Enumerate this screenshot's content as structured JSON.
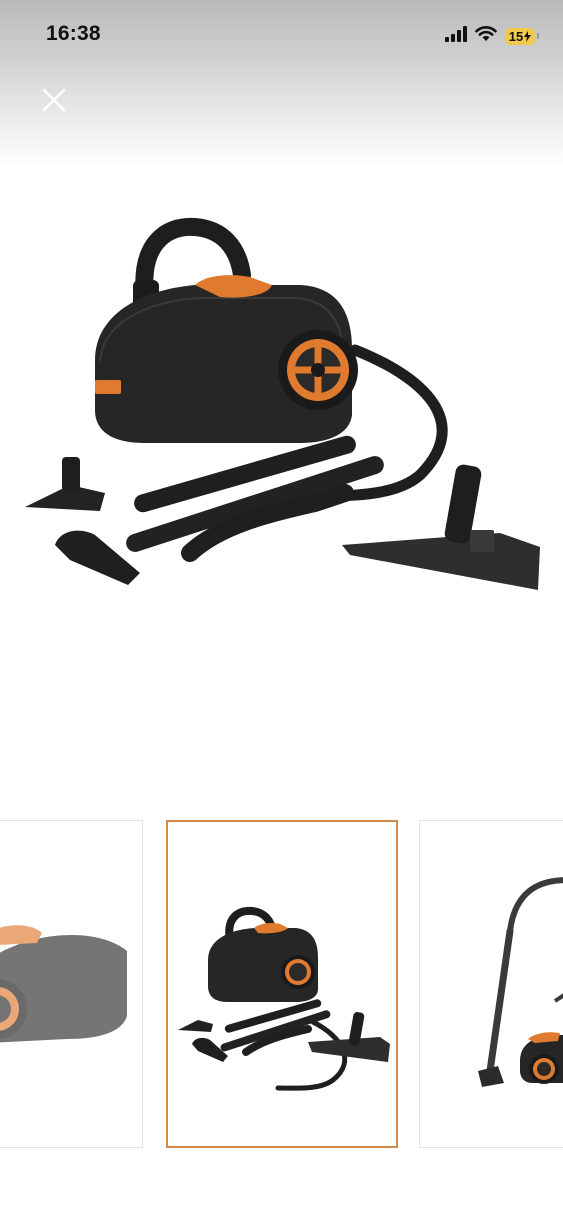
{
  "status_bar": {
    "time": "16:38",
    "battery_level": "15",
    "icons": [
      "cellular-signal-icon",
      "wifi-icon",
      "battery-charging-icon"
    ]
  },
  "toolbar": {
    "close_icon": "close-icon"
  },
  "gallery": {
    "selected_index": 1,
    "accent_color": "#d4894a",
    "product_colors": {
      "body": "#242424",
      "accent": "#e07a2e"
    },
    "thumbnails": [
      {
        "label": "vacuum-body-closeup"
      },
      {
        "label": "vacuum-with-accessories"
      },
      {
        "label": "vacuum-assembled-upright"
      }
    ]
  }
}
